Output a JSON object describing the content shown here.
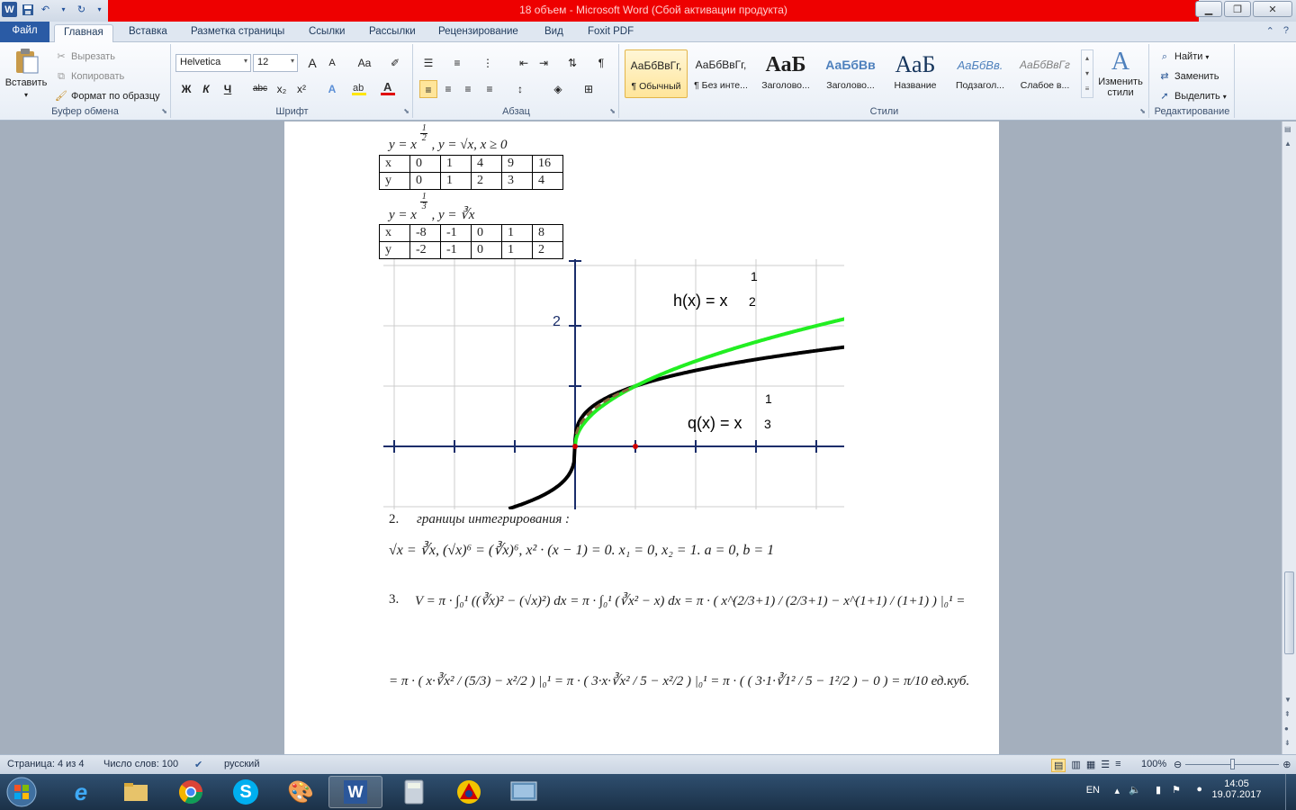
{
  "window": {
    "title": "18 объем  -  Microsoft Word (Сбой активации продукта)",
    "accent": "#2a5ba5",
    "title_band_color": "#ee0000"
  },
  "qat": {
    "word_icon": "W",
    "save_icon": "save-icon",
    "undo_icon": "undo-icon",
    "redo_icon": "redo-icon"
  },
  "tabs": [
    {
      "label": "Файл"
    },
    {
      "label": "Главная"
    },
    {
      "label": "Вставка"
    },
    {
      "label": "Разметка страницы"
    },
    {
      "label": "Ссылки"
    },
    {
      "label": "Рассылки"
    },
    {
      "label": "Рецензирование"
    },
    {
      "label": "Вид"
    },
    {
      "label": "Foxit PDF"
    }
  ],
  "ribbon": {
    "clipboard": {
      "label": "Буфер обмена",
      "paste": "Вставить",
      "cut": "Вырезать",
      "copy": "Копировать",
      "format_painter": "Формат по образцу"
    },
    "font": {
      "label": "Шрифт",
      "font_name": "Helvetica",
      "font_size": "12",
      "grow": "A",
      "shrink": "A",
      "case": "Aa",
      "bold": "Ж",
      "italic": "К",
      "underline": "Ч",
      "strike": "abc",
      "subscript": "x₂",
      "superscript": "x²"
    },
    "paragraph": {
      "label": "Абзац"
    },
    "styles": {
      "label": "Стили",
      "items": [
        {
          "preview": "АаБбВвГг,",
          "name": "¶ Обычный"
        },
        {
          "preview": "АаБбВвГг,",
          "name": "¶ Без инте..."
        },
        {
          "preview": "АаБ",
          "name": "Заголово..."
        },
        {
          "preview": "АаБбВв",
          "name": "Заголово..."
        },
        {
          "preview": "АаБ",
          "name": "Название"
        },
        {
          "preview": "АаБбВв.",
          "name": "Подзагол..."
        },
        {
          "preview": "АаБбВвГг",
          "name": "Слабое в..."
        }
      ],
      "change_styles_1": "Изменить",
      "change_styles_2": "стили"
    },
    "editing": {
      "label": "Редактирование",
      "find": "Найти",
      "replace": "Заменить",
      "select": "Выделить"
    }
  },
  "document": {
    "eq1_lhs": "y = x",
    "eq1_exp_num": "1",
    "eq1_exp_den": "2",
    "eq1_rhs": ",    y = √x, x ≥ 0",
    "table1": {
      "rows": [
        [
          "x",
          "0",
          "1",
          "4",
          "9",
          "16"
        ],
        [
          "y",
          "0",
          "1",
          "2",
          "3",
          "4"
        ]
      ]
    },
    "eq2_lhs": "y = x",
    "eq2_exp_num": "1",
    "eq2_exp_den": "3",
    "eq2_rhs": ",    y = ∛x",
    "table2": {
      "rows": [
        [
          "x",
          "-8",
          "-1",
          "0",
          "1",
          "8"
        ],
        [
          "y",
          "-2",
          "-1",
          "0",
          "1",
          "2"
        ]
      ]
    },
    "graph": {
      "ytick_label": "2",
      "h_label": "h(x) = x",
      "h_exp_num": "1",
      "h_exp_den": "2",
      "q_label": "q(x) = x",
      "q_exp_num": "1",
      "q_exp_den": "3",
      "h_color": "#22ee22",
      "q_color": "#000000"
    },
    "step2_number": "2.",
    "step2_text": "границы интегрирования :",
    "eq3": "√x = ∛x,  (√x)⁶ = (∛x)⁶,    x² · (x − 1) = 0.    x₁ = 0,    x₂ = 1.    a = 0, b = 1",
    "step3_number": "3.",
    "eq4": "V = π · ∫₀¹ ((∛x)² − (√x)²) dx = π · ∫₀¹ (∛x² − x) dx = π · ( x^(2/3+1) / (2/3+1) − x^(1+1) / (1+1) ) |₀¹ =",
    "eq5": "= π · ( x·∛x² / (5/3) − x²/2 ) |₀¹ = π · ( 3·x·∛x² / 5 − x²/2 ) |₀¹ = π · ( ( 3·1·∛1² / 5 − 1²/2 ) − 0 ) = π/10 ед.куб."
  },
  "status": {
    "page": "Страница: 4 из 4",
    "words": "Число слов: 100",
    "language": "русский",
    "zoom": "100%"
  },
  "taskbar": {
    "apps": [
      "start-icon",
      "ie-icon",
      "explorer-icon",
      "chrome-icon",
      "skype-icon",
      "paint-icon",
      "word-icon",
      "calculator-icon",
      "app-icon",
      "screen-icon"
    ],
    "lang": "EN",
    "time": "14:05",
    "date": "19.07.2017"
  }
}
